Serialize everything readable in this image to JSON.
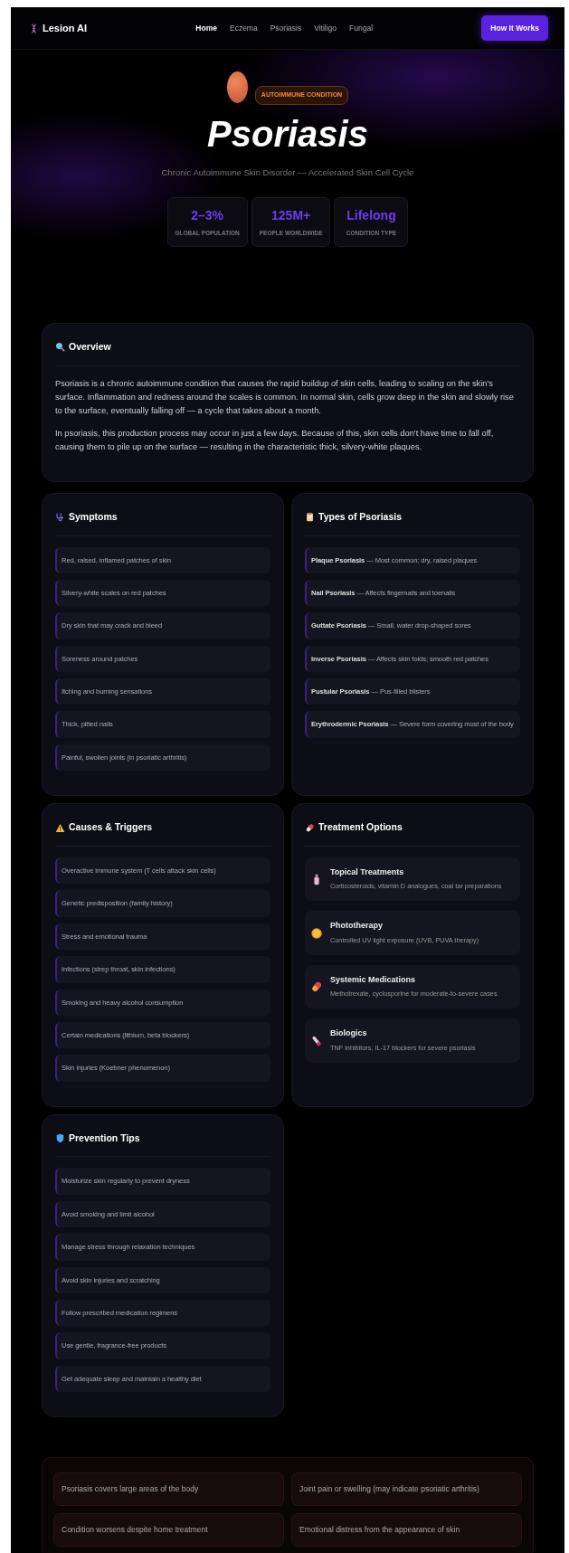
{
  "nav": {
    "brand": "Lesion AI",
    "links": [
      {
        "label": "Home",
        "selected": true
      },
      {
        "label": "Eczema",
        "selected": false
      },
      {
        "label": "Psoriasis",
        "selected": false
      },
      {
        "label": "Vitiligo",
        "selected": false
      },
      {
        "label": "Fungal",
        "selected": false
      }
    ],
    "button": "How It Works"
  },
  "hero": {
    "badge": "AUTOIMMUNE CONDITION",
    "title": "Psoriasis",
    "subtitle": "Chronic Autoimmune Skin Disorder — Accelerated Skin Cell Cycle",
    "stats": [
      {
        "value": "2–3%",
        "label": "GLOBAL POPULATION"
      },
      {
        "value": "125M+",
        "label": "PEOPLE WORLDWIDE"
      },
      {
        "value": "Lifelong",
        "label": "CONDITION TYPE"
      }
    ]
  },
  "overview": {
    "title": "Overview",
    "paragraphs": [
      "Psoriasis is a chronic autoimmune condition that causes the rapid buildup of skin cells, leading to scaling on the skin's surface. Inflammation and redness around the scales is common. In normal skin, cells grow deep in the skin and slowly rise to the surface, eventually falling off — a cycle that takes about a month.",
      "In psoriasis, this production process may occur in just a few days. Because of this, skin cells don't have time to fall off, causing them to pile up on the surface — resulting in the characteristic thick, silvery-white plaques."
    ]
  },
  "sections": [
    {
      "kind": "list",
      "title": "Symptoms",
      "items": [
        "Red, raised, inflamed patches of skin",
        "Silvery-white scales on red patches",
        "Dry skin that may crack and bleed",
        "Soreness around patches",
        "Itching and burning sensations",
        "Thick, pitted nails",
        "Painful, swollen joints (in psoriatic arthritis)"
      ]
    },
    {
      "kind": "list",
      "title": "Types of Psoriasis",
      "items": [
        "**Plaque Psoriasis** — Most common; dry, raised plaques",
        "**Nail Psoriasis** — Affects fingernails and toenails",
        "**Guttate Psoriasis** — Small, water drop-shaped sores",
        "**Inverse Psoriasis** — Affects skin folds; smooth red patches",
        "**Pustular Psoriasis** — Pus-filled blisters",
        "**Erythrodermic Psoriasis** — Severe form covering most of the body"
      ]
    },
    {
      "kind": "list",
      "title": "Causes & Triggers",
      "items": [
        "Overactive immune system (T cells attack skin cells)",
        "Genetic predisposition (family history)",
        "Stress and emotional trauma",
        "Infections (strep throat, skin infections)",
        "Smoking and heavy alcohol consumption",
        "Certain medications (lithium, beta blockers)",
        "Skin injuries (Koebner phenomenon)"
      ]
    },
    {
      "kind": "treatments",
      "title": "Treatment Options",
      "items": [
        {
          "title": "Topical Treatments",
          "text": "Corticosteroids, vitamin D analogues, coal tar preparations"
        },
        {
          "title": "Phototherapy",
          "text": "Controlled UV light exposure (UVB, PUVA therapy)"
        },
        {
          "title": "Systemic Medications",
          "text": "Methotrexate, cyclosporine for moderate-to-severe cases"
        },
        {
          "title": "Biologics",
          "text": "TNF inhibitors, IL-17 blockers for severe psoriasis"
        }
      ]
    },
    {
      "kind": "list",
      "title": "Prevention Tips",
      "items": [
        "Moisturize skin regularly to prevent dryness",
        "Avoid smoking and limit alcohol",
        "Manage stress through relaxation techniques",
        "Avoid skin injuries and scratching",
        "Follow prescribed medication regimens",
        "Use gentle, fragrance-free products",
        "Get adequate sleep and maintain a healthy diet"
      ]
    }
  ],
  "warnings": [
    "Psoriasis covers large areas of the body",
    "Joint pain or swelling (may indicate psoriatic arthritis)",
    "Condition worsens despite home treatment",
    "Emotional distress from the appearance of skin"
  ]
}
